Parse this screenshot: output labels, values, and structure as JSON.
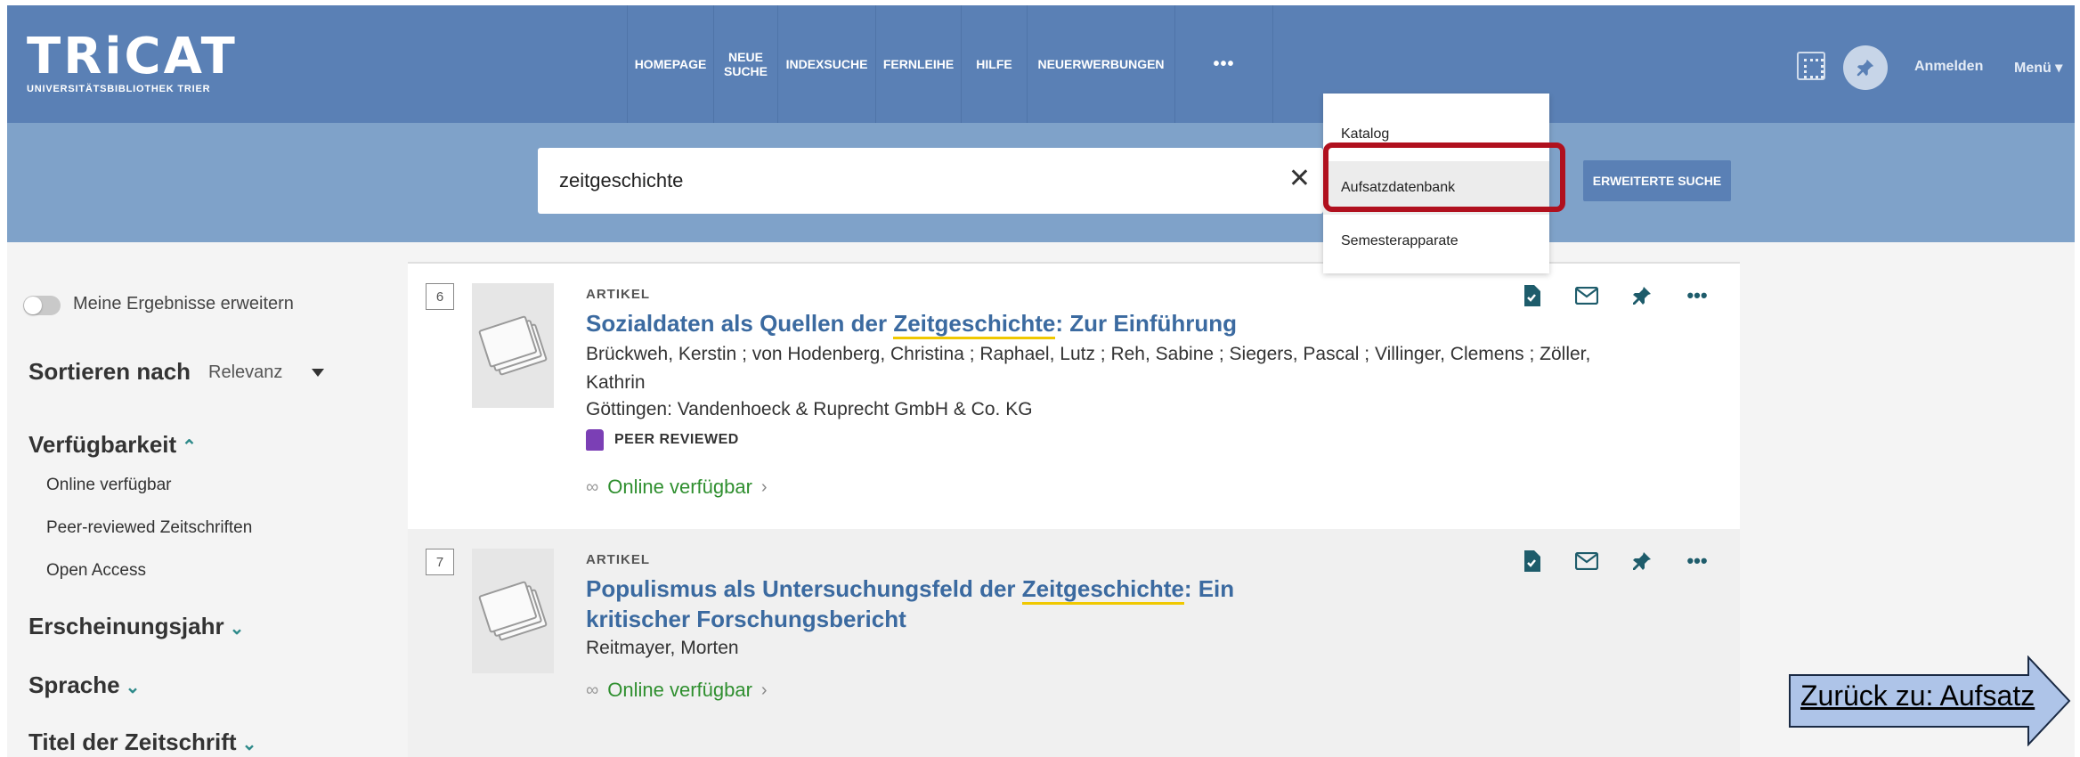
{
  "header": {
    "logo_main": "TRiCAT",
    "logo_sub": "UNIVERSITÄTSBIBLIOTHEK TRIER",
    "nav": [
      {
        "label": "HOMEPAGE"
      },
      {
        "label": "NEUE SUCHE"
      },
      {
        "label": "INDEXSUCHE"
      },
      {
        "label": "FERNLEIHE"
      },
      {
        "label": "HILFE"
      },
      {
        "label": "NEUERWERBUNGEN"
      },
      {
        "label": "•••"
      }
    ],
    "login": "Anmelden",
    "menu": "Menü ▾"
  },
  "search": {
    "query": "zeitgeschichte",
    "clear_icon": "✕",
    "advanced_label": "ERWEITERTE SUCHE"
  },
  "dropdown": {
    "items": [
      "Katalog",
      "Aufsatzdatenbank",
      "Semesterapparate"
    ],
    "active_index": 1
  },
  "sidebar": {
    "toggle_label": "Meine Ergebnisse erweitern",
    "sort_label": "Sortieren nach",
    "sort_value": "Relevanz",
    "facets": [
      {
        "title": "Verfügbarkeit",
        "chevron": "⌃",
        "items": [
          "Online verfügbar",
          "Peer-reviewed Zeitschriften",
          "Open Access"
        ]
      },
      {
        "title": "Erscheinungsjahr",
        "chevron": "⌄",
        "items": []
      },
      {
        "title": "Sprache",
        "chevron": "⌄",
        "items": []
      },
      {
        "title": "Titel der Zeitschrift",
        "chevron": "⌄",
        "items": []
      }
    ]
  },
  "results": [
    {
      "number": "6",
      "type": "ARTIKEL",
      "title_pre": "Sozialdaten als Quellen der ",
      "title_hl": "Zeitgeschichte",
      "title_post": ": Zur Einführung",
      "authors": "Brückweh, Kerstin ; von Hodenberg, Christina ; Raphael, Lutz ; Reh, Sabine ; Siegers, Pascal ; Villinger, Clemens ; Zöller, Kathrin",
      "publisher": "Göttingen: Vandenhoeck & Ruprecht GmbH & Co. KG",
      "peer": "PEER REVIEWED",
      "online": "Online verfügbar"
    },
    {
      "number": "7",
      "type": "ARTIKEL",
      "title_pre": "Populismus als Untersuchungsfeld der ",
      "title_hl": "Zeitgeschichte",
      "title_post": ": Ein kritischer Forschungsbericht",
      "authors": "Reitmayer, Morten",
      "online": "Online verfügbar"
    }
  ],
  "action_icons": [
    "citation-icon",
    "email-icon",
    "pin-icon",
    "more-icon"
  ],
  "back_button": "Zurück zu: Aufsatz",
  "colors": {
    "header": "#5a80b5",
    "search_band": "#7fa2c9",
    "highlight_border": "#b0101e",
    "title_link": "#3b6aa0",
    "online_green": "#2f8f2f"
  }
}
